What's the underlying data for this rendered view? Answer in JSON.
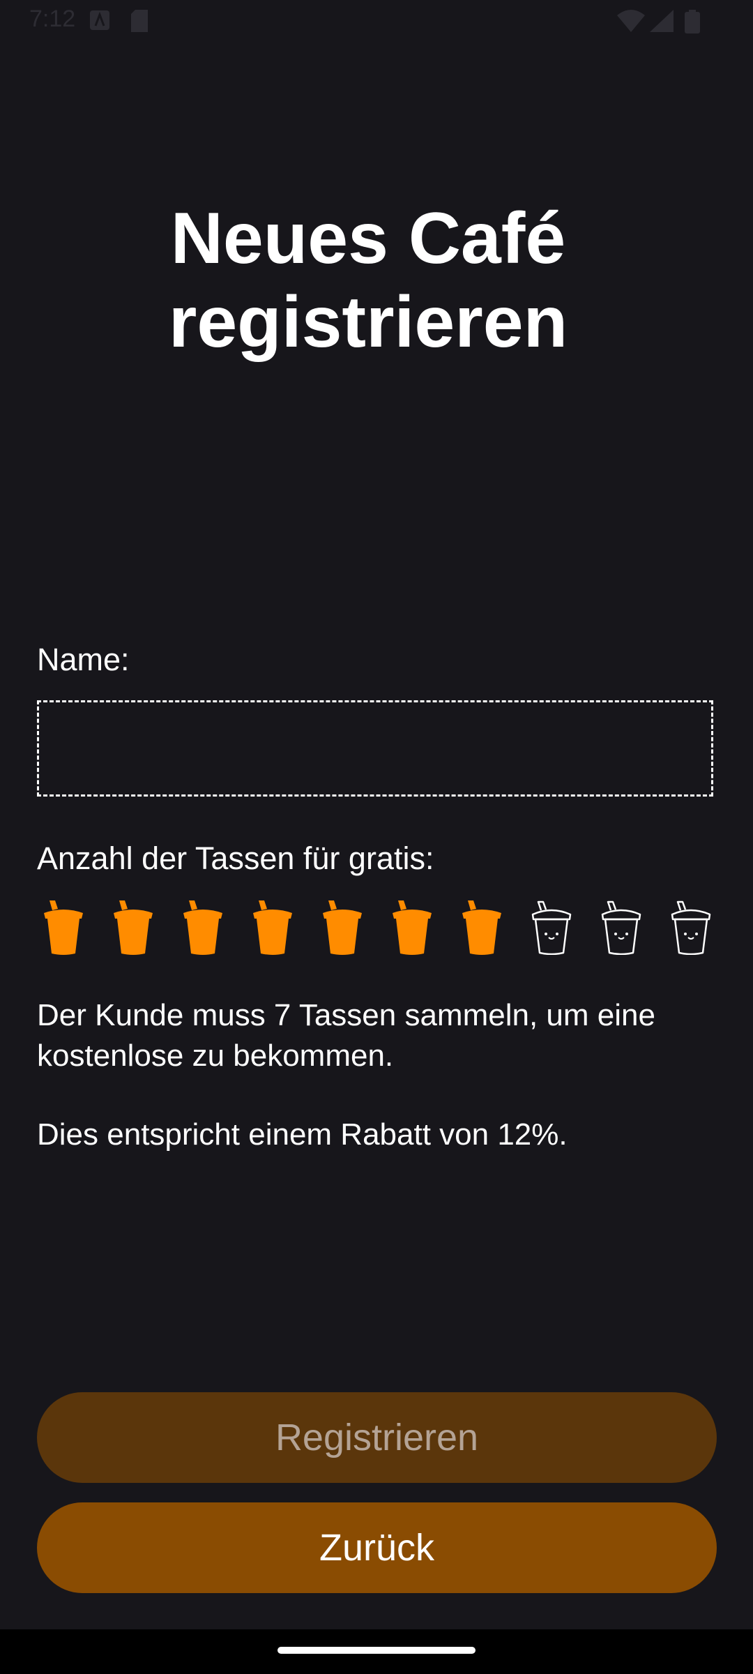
{
  "status_bar": {
    "time": "7:12"
  },
  "page": {
    "title_line1": "Neues Café",
    "title_line2": "registrieren"
  },
  "form": {
    "name_label": "Name:",
    "name_value": "",
    "name_placeholder": "",
    "cups_label": "Anzahl der Tassen für gratis:",
    "cups_total": 10,
    "cups_selected": 7,
    "filled_color": "#ff8c00",
    "outline_color": "#ffffff"
  },
  "info": {
    "line1": "Der Kunde muss 7 Tassen sammeln, um eine kostenlose zu bekommen.",
    "line2": "Dies entspricht einem Rabatt von 12%."
  },
  "buttons": {
    "register_label": "Registrieren",
    "back_label": "Zurück"
  }
}
